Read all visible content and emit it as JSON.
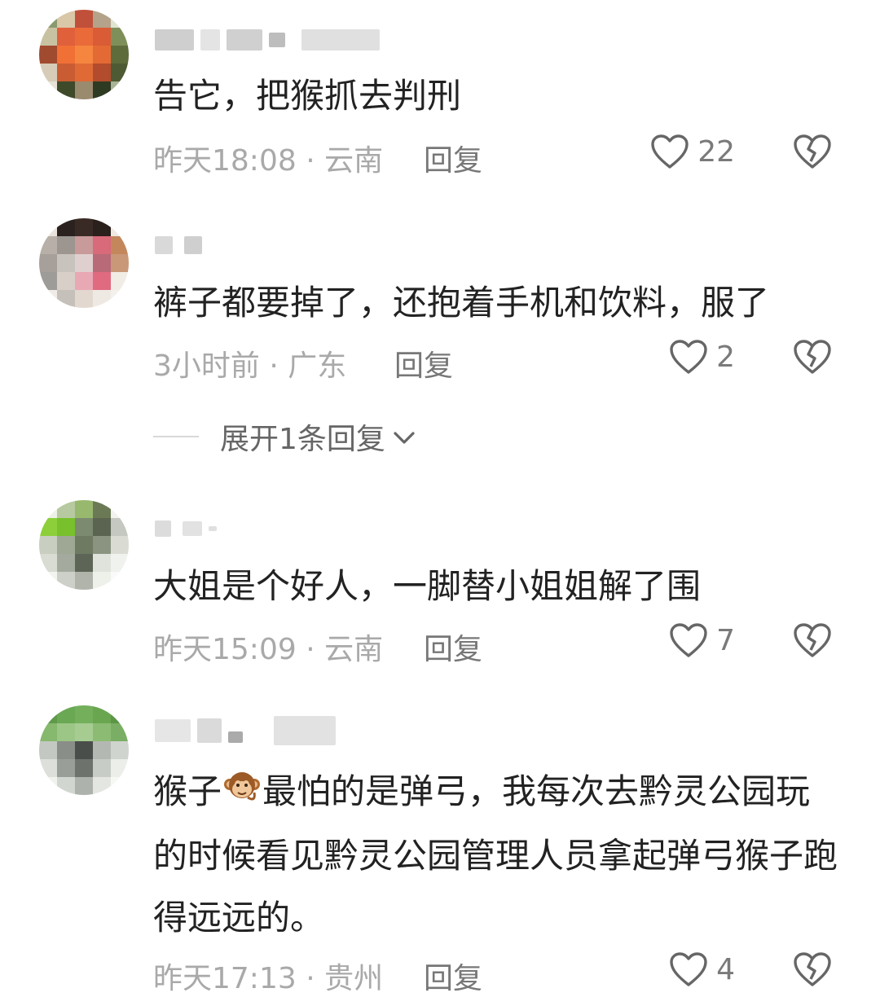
{
  "comments": [
    {
      "text": "告它，把猴抓去判刑",
      "meta": "昨天18:08 · 云南",
      "reply_label": "回复",
      "likes": "22"
    },
    {
      "text": "裤子都要掉了，还抱着手机和饮料，服了",
      "meta": "3小时前 · 广东",
      "reply_label": "回复",
      "likes": "2",
      "expand_label": "展开1条回复"
    },
    {
      "text": "大姐是个好人，一脚替小姐姐解了围",
      "meta": "昨天15:09 · 云南",
      "reply_label": "回复",
      "likes": "7"
    },
    {
      "text_before_emoji": "猴子",
      "emoji": "monkey-emoji",
      "text_after_emoji": "最怕的是弹弓，我每次去黔灵公园玩的时候看见黔灵公园管理人员拿起弹弓猴子跑得远远的。",
      "meta": "昨天17:13 · 贵州",
      "reply_label": "回复",
      "likes": "4"
    }
  ],
  "icons": {
    "like": "heart-outline-icon",
    "dislike": "broken-heart-icon",
    "expand": "chevron-down-icon"
  },
  "colors": {
    "text": "#222222",
    "meta": "#a9a9a9",
    "action": "#777777"
  }
}
